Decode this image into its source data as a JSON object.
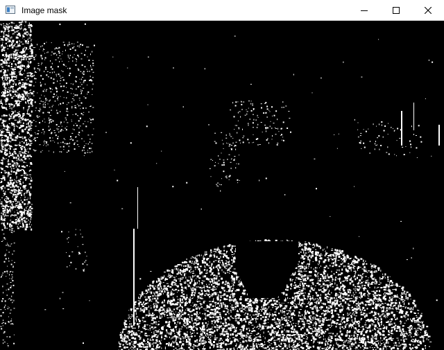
{
  "window": {
    "title": "Image mask",
    "app_icon": "window-app-icon",
    "controls": {
      "minimize_icon": "minimize-icon",
      "maximize_icon": "maximize-icon",
      "close_icon": "close-icon"
    }
  },
  "image": {
    "kind": "binary-mask",
    "foreground_color": "#ffffff",
    "background_color": "#000000"
  }
}
